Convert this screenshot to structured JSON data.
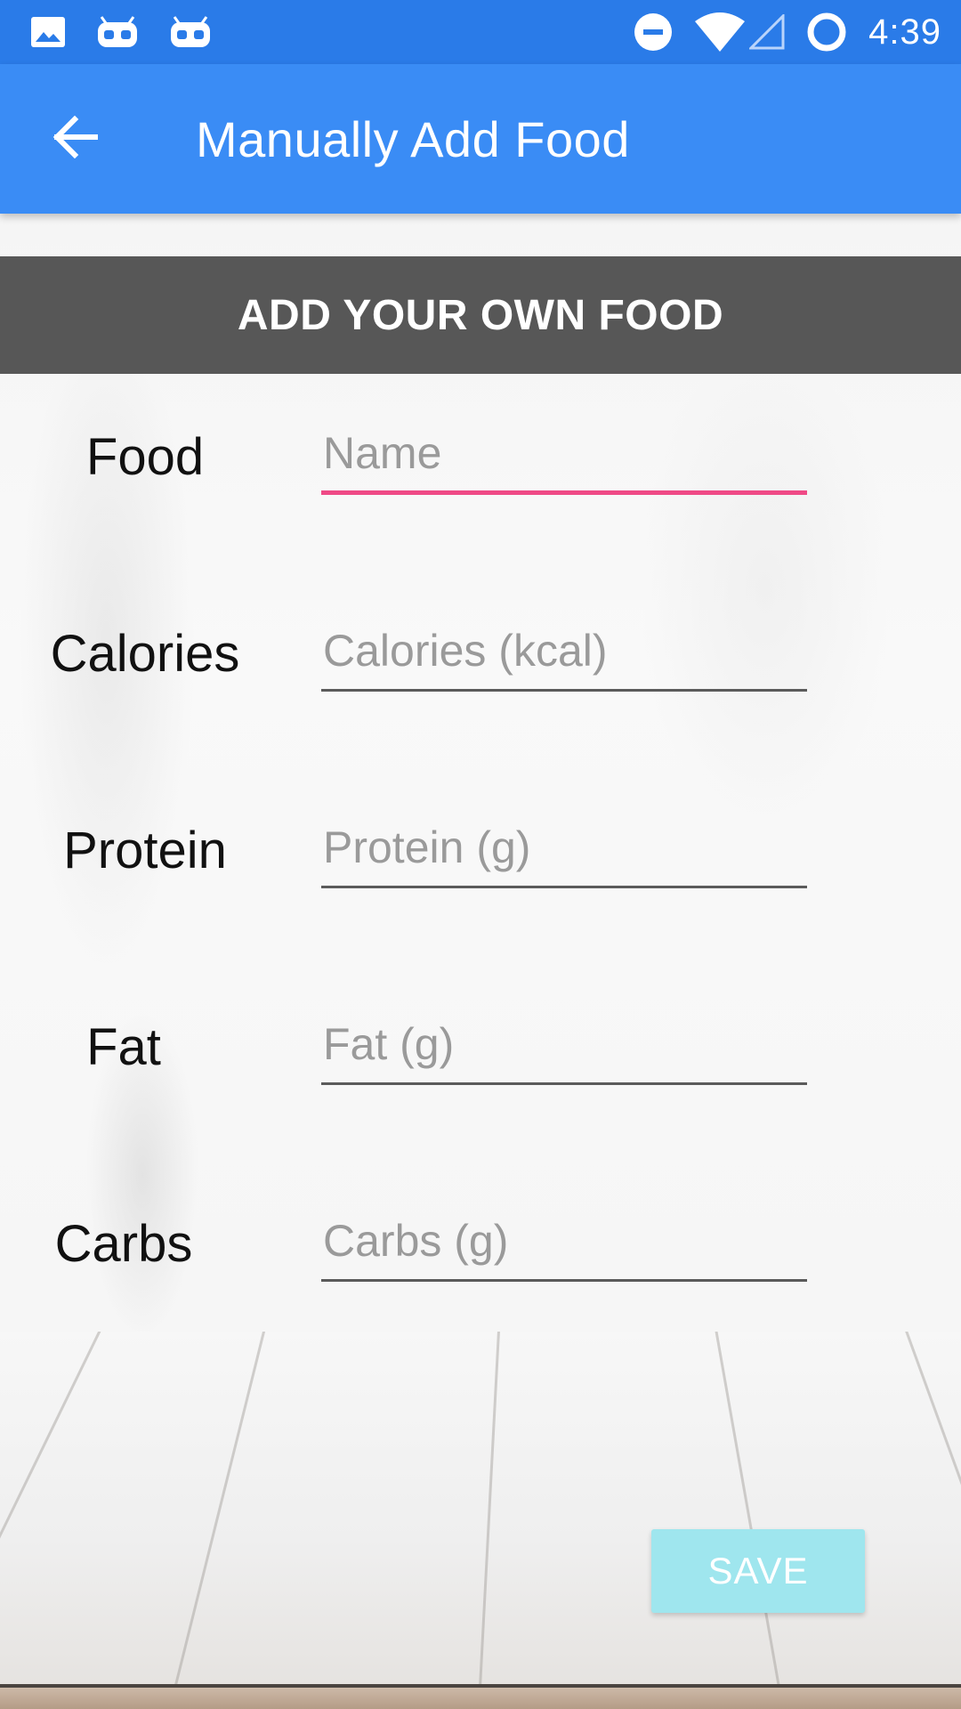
{
  "status_bar": {
    "time": "4:39",
    "left_icons": [
      "image-icon",
      "android-icon",
      "android-icon"
    ],
    "right_icons": [
      "do-not-disturb-icon",
      "wifi-icon",
      "cell-signal-icon",
      "sync-circle-icon"
    ]
  },
  "app_bar": {
    "title": "Manually Add Food",
    "back_icon": "arrow-back-icon"
  },
  "section": {
    "header": "ADD YOUR OWN FOOD"
  },
  "form": {
    "food": {
      "label": "Food",
      "placeholder": "Name",
      "value": ""
    },
    "calories": {
      "label": "Calories",
      "placeholder": "Calories (kcal)",
      "value": ""
    },
    "protein": {
      "label": "Protein",
      "placeholder": "Protein (g)",
      "value": ""
    },
    "fat": {
      "label": "Fat",
      "placeholder": "Fat (g)",
      "value": ""
    },
    "carbs": {
      "label": "Carbs",
      "placeholder": "Carbs (g)",
      "value": ""
    }
  },
  "save_button": {
    "label": "SAVE"
  },
  "colors": {
    "status_bar": "#2a7be8",
    "app_bar": "#3a8cf5",
    "section_header": "#575757",
    "focus_underline": "#ef4a86",
    "save_button": "#9fe6ee"
  }
}
